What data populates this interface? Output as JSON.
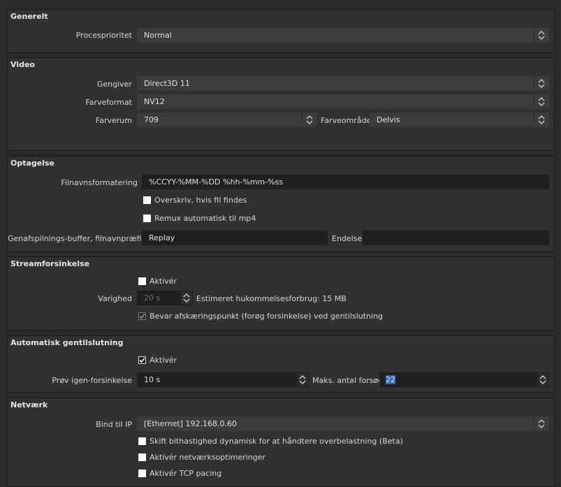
{
  "general": {
    "title": "Generelt",
    "priority_label": "Procesprioritet",
    "priority_value": "Normal"
  },
  "video": {
    "title": "Video",
    "renderer_label": "Gengiver",
    "renderer_value": "Direct3D 11",
    "color_format_label": "Farveformat",
    "color_format_value": "NV12",
    "color_space_label": "Farverum",
    "color_space_value": "709",
    "color_range_label": "Farveområde",
    "color_range_value": "Delvis"
  },
  "recording": {
    "title": "Optagelse",
    "filename_format_label": "Filnavnsformatering",
    "filename_format_value": "%CCYY-%MM-%DD %hh-%mm-%ss",
    "overwrite_label": "Overskriv, hvis fil findes",
    "overwrite_checked": false,
    "remux_label": "Remux automatisk til mp4",
    "remux_checked": false,
    "replay_prefix_label": "Genafspilnings-buffer, filnavnpræfiks",
    "replay_prefix_value": "Replay",
    "suffix_label": "Endelse",
    "suffix_value": ""
  },
  "stream_delay": {
    "title": "Streamforsinkelse",
    "enable_label": "Aktivér",
    "enable_checked": false,
    "duration_label": "Varighed",
    "duration_value": "20 s",
    "memory_estimate": "Estimeret hukommelsesforbrug: 15 MB",
    "preserve_label": "Bevar afskæringspunkt (forøg forsinkelse) ved gentilslutning",
    "preserve_checked": true
  },
  "reconnect": {
    "title": "Automatisk gentilslutning",
    "enable_label": "Aktivér",
    "enable_checked": true,
    "retry_delay_label": "Prøv igen-forsinkelse",
    "retry_delay_value": "10 s",
    "max_retries_label": "Maks. antal forsøg",
    "max_retries_value": "22"
  },
  "network": {
    "title": "Netværk",
    "bind_ip_label": "Bind til IP",
    "bind_ip_value": "[Ethernet]  192.168.0.60",
    "dynamic_bitrate_label": "Skift bithastighed dynamisk for at håndtere overbelastning (Beta)",
    "optimizations_label": "Aktivér netværksoptimeringer",
    "tcp_pacing_label": "Aktivér TCP pacing"
  },
  "colors": {
    "background": "#2b2b2b",
    "group": "#313131",
    "input": "#1f1f1f",
    "combo": "#3c3c3c",
    "selection": "#2a6ac9"
  }
}
